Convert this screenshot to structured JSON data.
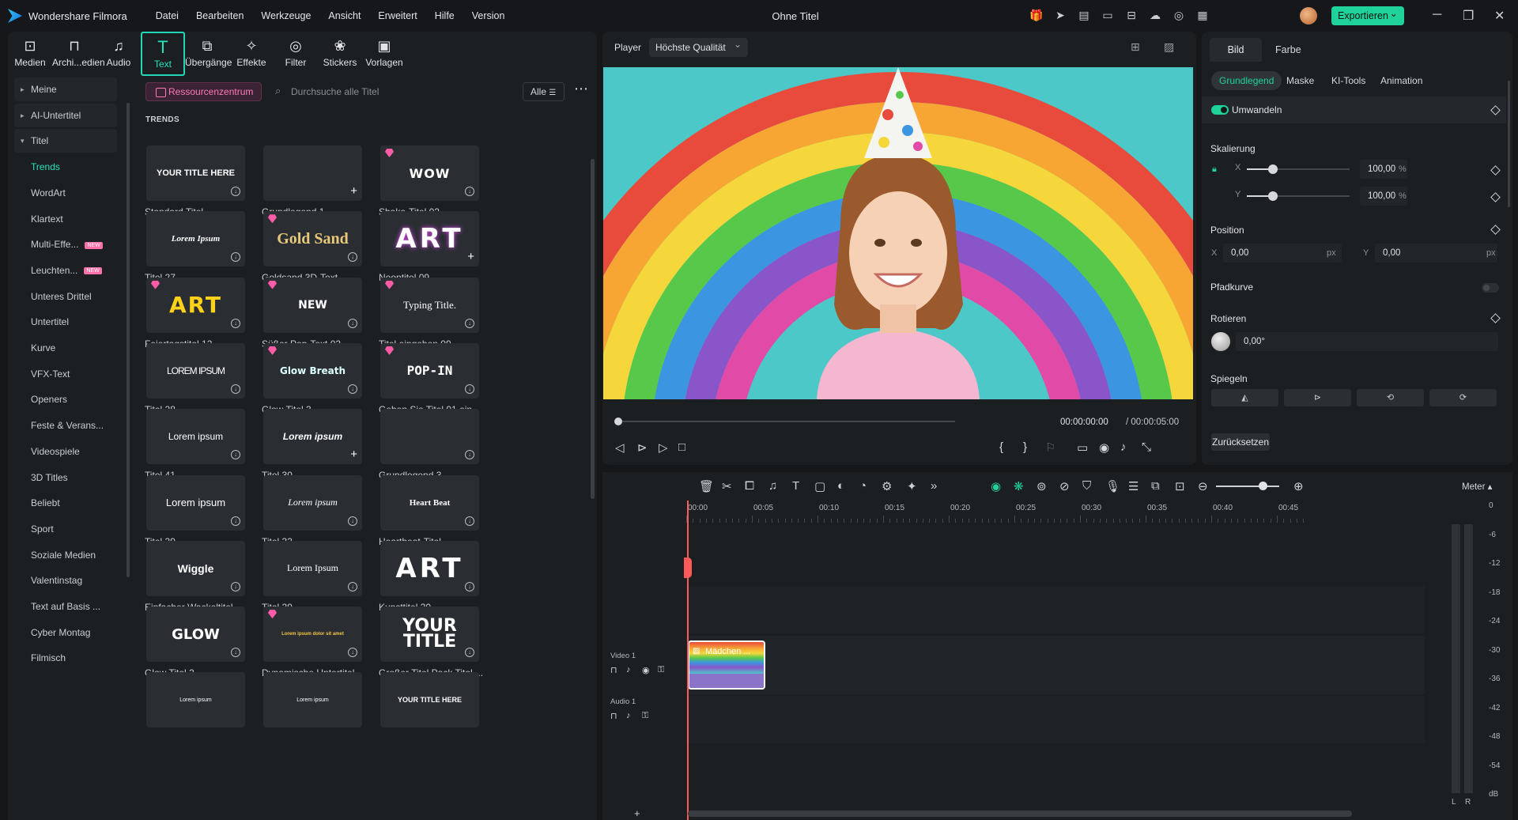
{
  "titlebar": {
    "app_name": "Wondershare Filmora",
    "menu": [
      "Datei",
      "Bearbeiten",
      "Werkzeuge",
      "Ansicht",
      "Erweitert",
      "Hilfe",
      "Version"
    ],
    "window_title": "Ohne Titel",
    "export_label": "Exportieren",
    "icons": [
      "gift-icon",
      "send-icon",
      "media-stack-icon",
      "monitor-icon",
      "save-icon",
      "cloud-icon",
      "headset-icon",
      "apps-grid-icon"
    ]
  },
  "toptools": [
    {
      "label": "Medien",
      "icon": "media-icon"
    },
    {
      "label": "Archi...edien",
      "icon": "archive-icon"
    },
    {
      "label": "Audio",
      "icon": "music-note-icon"
    },
    {
      "label": "Text",
      "icon": "text-t-icon",
      "active": true
    },
    {
      "label": "Übergänge",
      "icon": "transition-icon"
    },
    {
      "label": "Effekte",
      "icon": "effects-icon"
    },
    {
      "label": "Filter",
      "icon": "filter-icon"
    },
    {
      "label": "Stickers",
      "icon": "sticker-icon"
    },
    {
      "label": "Vorlagen",
      "icon": "template-icon"
    }
  ],
  "sidebar": {
    "items": [
      {
        "label": "Meine",
        "type": "group"
      },
      {
        "label": "AI-Untertitel",
        "type": "group"
      },
      {
        "label": "Titel",
        "type": "group-open"
      },
      {
        "label": "Trends",
        "type": "selected"
      },
      {
        "label": "WordArt"
      },
      {
        "label": "Klartext"
      },
      {
        "label": "Multi-Effe...",
        "badge": "NEW"
      },
      {
        "label": "Leuchten...",
        "badge": "NEW"
      },
      {
        "label": "Unteres Drittel"
      },
      {
        "label": "Untertitel"
      },
      {
        "label": "Kurve"
      },
      {
        "label": "VFX-Text"
      },
      {
        "label": "Openers"
      },
      {
        "label": "Feste & Verans..."
      },
      {
        "label": "Videospiele"
      },
      {
        "label": "3D Titles"
      },
      {
        "label": "Beliebt"
      },
      {
        "label": "Sport"
      },
      {
        "label": "Soziale Medien"
      },
      {
        "label": "Valentinstag"
      },
      {
        "label": "Text auf Basis ..."
      },
      {
        "label": "Cyber Montag"
      },
      {
        "label": "Filmisch"
      }
    ]
  },
  "content": {
    "resource_center": "Ressourcenzentrum",
    "search_placeholder": "Durchsuche alle Titel",
    "filter_label": "Alle",
    "section_title": "TRENDS",
    "cards": [
      {
        "name": "Standard Titel",
        "thumb_text": "YOUR TITLE HERE",
        "action": "download"
      },
      {
        "name": "Grundlegend 1",
        "thumb_text": "",
        "action": "add"
      },
      {
        "name": "Shake-Titel 02",
        "thumb_text": "WOW",
        "premium": true,
        "action": "download"
      },
      {
        "name": "Titel 27",
        "thumb_text": "Lorem Ipsum",
        "action": "download"
      },
      {
        "name": "Goldsand 3D-Text",
        "thumb_text": "Gold Sand",
        "premium": true,
        "action": "download"
      },
      {
        "name": "Neontitel 09",
        "thumb_text": "ART",
        "action": "add"
      },
      {
        "name": "Feiertagstitel 12",
        "thumb_text": "ART",
        "premium": true,
        "action": "download"
      },
      {
        "name": "Süßer Pop-Text 02",
        "thumb_text": "NEW",
        "premium": true,
        "action": "download"
      },
      {
        "name": "Titel eingeben 09",
        "thumb_text": "Typing Title.",
        "premium": true,
        "action": "download"
      },
      {
        "name": "Titel 28",
        "thumb_text": "LOREM IPSUM",
        "action": "download"
      },
      {
        "name": "Glow Titel 3",
        "thumb_text": "Glow Breath",
        "premium": true,
        "action": "download"
      },
      {
        "name": "Geben Sie Titel 01 ein",
        "thumb_text": "POP-IN",
        "premium": true,
        "action": "download"
      },
      {
        "name": "Titel 41",
        "thumb_text": "Lorem ipsum",
        "action": "download"
      },
      {
        "name": "Titel 30",
        "thumb_text": "Lorem ipsum",
        "action": "add"
      },
      {
        "name": "Grundlegend 3",
        "thumb_text": "",
        "action": "download"
      },
      {
        "name": "Titel 39",
        "thumb_text": "Lorem ipsum",
        "action": "download"
      },
      {
        "name": "Titel 33",
        "thumb_text": "Lorem ipsum",
        "action": "download"
      },
      {
        "name": "Heartbeat-Titel",
        "thumb_text": "Heart Beat",
        "action": "download"
      },
      {
        "name": "Einfacher Wackeltitel",
        "thumb_text": "Wiggle",
        "action": "download"
      },
      {
        "name": "Titel 29",
        "thumb_text": "Lorem Ipsum",
        "action": "download"
      },
      {
        "name": "Kunsttitel 30",
        "thumb_text": "ART",
        "action": "download"
      },
      {
        "name": "Glow Titel 2",
        "thumb_text": "GLOW",
        "action": "download"
      },
      {
        "name": "Dynamische Untertitel...",
        "thumb_text": "Lorem ipsum dolor sit amet",
        "premium": true,
        "action": "download"
      },
      {
        "name": "Großer Titel Pack Titel ...",
        "thumb_text": "YOUR TITLE",
        "action": "download"
      },
      {
        "name": "",
        "thumb_text": "Lorem ipsum",
        "action": ""
      },
      {
        "name": "",
        "thumb_text": "Lorem ipsum",
        "action": ""
      },
      {
        "name": "",
        "thumb_text": "YOUR TITLE HERE",
        "action": ""
      }
    ]
  },
  "player": {
    "label": "Player",
    "quality": "Höchste Qualität",
    "current_time": "00:00:00:00",
    "total_time": "/ 00:00:05:00",
    "progress": 0
  },
  "properties": {
    "tabs": [
      "Bild",
      "Farbe"
    ],
    "subtabs": [
      "Grundlegend",
      "Maske",
      "KI-Tools",
      "Animation"
    ],
    "transform_label": "Umwandeln",
    "scale_label": "Skalierung",
    "scale_x": "100,00",
    "scale_y": "100,00",
    "percent_unit": "%",
    "axis_x": "X",
    "axis_y": "Y",
    "scale_slider_value": 0.25,
    "position_label": "Position",
    "pos_x": "0,00",
    "pos_y": "0,00",
    "px_unit": "px",
    "path_curve_label": "Pfadkurve",
    "rotate_label": "Rotieren",
    "rotate_value": "0,00°",
    "mirror_label": "Spiegeln",
    "reset_label": "Zurücksetzen"
  },
  "timeline": {
    "ruler": [
      "00:00",
      "00:05",
      "00:10",
      "00:15",
      "00:20",
      "00:25",
      "00:30",
      "00:35",
      "00:40",
      "00:45"
    ],
    "video_track": "Video 1",
    "audio_track": "Audio 1",
    "clip_title": "Mädchen ...",
    "meter_label": "Meter",
    "db_scale": [
      "0",
      "-6",
      "-12",
      "-18",
      "-24",
      "-30",
      "-36",
      "-42",
      "-48",
      "-54",
      "dB"
    ],
    "lr": [
      "L",
      "R"
    ],
    "add_track": "+"
  }
}
